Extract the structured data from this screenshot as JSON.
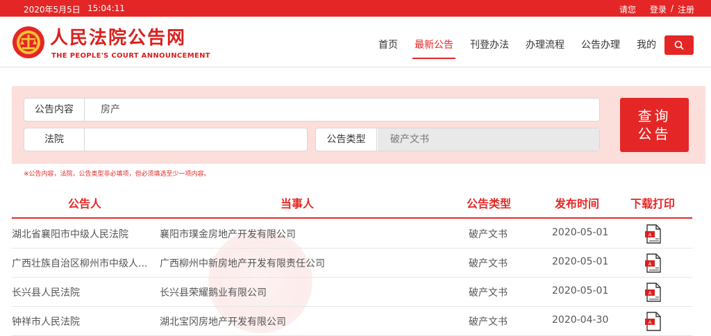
{
  "topbar": {
    "date": "2020年5月5日",
    "time": "15:04:11",
    "greeting": "请您",
    "login": "登录",
    "separator": "/",
    "register": "注册"
  },
  "header": {
    "title": "人民法院公告网",
    "subtitle": "THE PEOPLE'S COURT ANNOUNCEMENT",
    "nav": [
      "首页",
      "最新公告",
      "刊登办法",
      "办理流程",
      "公告办理",
      "我的"
    ],
    "active_nav": "最新公告",
    "search_icon": "search-icon"
  },
  "search": {
    "content_label": "公告内容",
    "content_value": "房产",
    "court_label": "法院",
    "court_value": "",
    "type_label": "公告类型",
    "type_value": "破产文书",
    "button_line1": "查询",
    "button_line2": "公告",
    "hint": "※公告内容，法院，公告类型非必填项，但必须填选至少一项内容。"
  },
  "table": {
    "headers": [
      "公告人",
      "当事人",
      "公告类型",
      "发布时间",
      "下载打印"
    ],
    "rows": [
      {
        "announcer": "湖北省襄阳市中级人民法院",
        "party": "襄阳市璞金房地产开发有限公司",
        "type": "破产文书",
        "date": "2020-05-01",
        "icon": "pdf-icon"
      },
      {
        "announcer": "广西壮族自治区柳州市中级人...",
        "party": "广西柳州中新房地产开发有限责任公司",
        "type": "破产文书",
        "date": "2020-05-01",
        "icon": "pdf-icon"
      },
      {
        "announcer": "长兴县人民法院",
        "party": "长兴县荣耀鹅业有限公司",
        "type": "破产文书",
        "date": "2020-05-01",
        "icon": "pdf-icon"
      },
      {
        "announcer": "钟祥市人民法院",
        "party": "湖北宝冈房地产开发有限公司",
        "type": "破产文书",
        "date": "2020-04-30",
        "icon": "pdf-icon"
      }
    ]
  },
  "colors": {
    "brand_red": "#e42726",
    "panel_bg": "#fcdedb"
  }
}
